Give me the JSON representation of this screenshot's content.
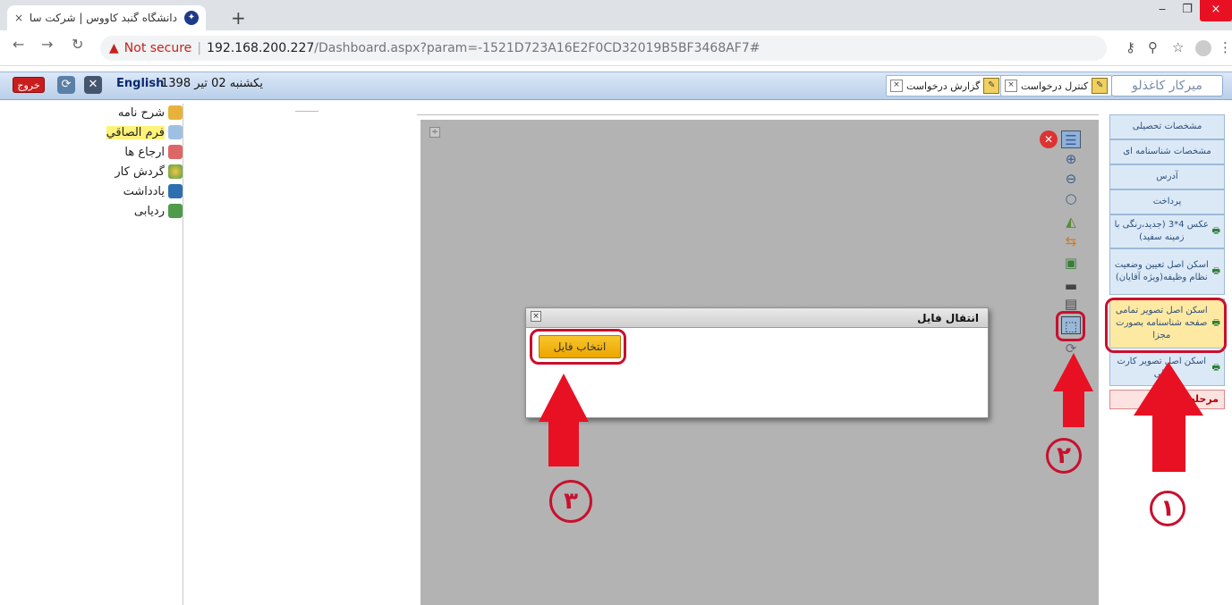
{
  "browser": {
    "tab_title": "دانشگاه گنبد کاووس | شرکت سامان",
    "tab_close": "×",
    "new_tab": "+",
    "security_label": "Not secure",
    "url_host": "192.168.200.227",
    "url_path": "/Dashboard.aspx?param=-1521D723A16E2F0CD32019B5BF3468AF7#",
    "window_controls": [
      "‒",
      "❐",
      "×"
    ]
  },
  "toolbar": {
    "exit_label": "خروج",
    "language": "English",
    "date": "یکشنبه 02 تیر 1398",
    "username": "میرکار کاغذلو",
    "doc_tabs": [
      "کنترل درخواست",
      "گزارش درخواست"
    ]
  },
  "left_panel": {
    "items": [
      {
        "label": "شرح نامه",
        "icon": "envelope-icon",
        "selected": false
      },
      {
        "label": "فرم الصاقي",
        "icon": "document-icon",
        "selected": true
      },
      {
        "label": "ارجاع ها",
        "icon": "forward-icon",
        "selected": false
      },
      {
        "label": "گردش کار",
        "icon": "workflow-icon",
        "selected": false
      },
      {
        "label": "یادداشت",
        "icon": "note-icon",
        "selected": false
      },
      {
        "label": "ردیابی",
        "icon": "tracking-icon",
        "selected": false
      }
    ]
  },
  "viewer": {
    "toggle": "÷",
    "tools": [
      "list-icon",
      "zoom-in-icon",
      "zoom-out-icon",
      "zoom-fit-icon",
      "rotate-icon",
      "swap-icon",
      "save-icon",
      "print-icon",
      "scanner-icon",
      "upload-icon",
      "refresh-icon"
    ]
  },
  "dialog": {
    "title": "انتقال فایل",
    "close": "×",
    "select_file_label": "انتخاب فایل"
  },
  "right_panel": {
    "items": [
      {
        "label": "مشخصات تحصیلی",
        "printer": false,
        "highlight": false
      },
      {
        "label": "مشخصات شناسنامه ای",
        "printer": false,
        "highlight": false
      },
      {
        "label": "آدرس",
        "printer": false,
        "highlight": false
      },
      {
        "label": "پرداخت",
        "printer": false,
        "highlight": false
      },
      {
        "label": "عکس 4*3 (جدید،رنگی با زمینه سفید)",
        "printer": true,
        "highlight": false
      },
      {
        "label": "اسکن اصل تعیین وضعیت نظام وظیفه(ویژه آقایان)",
        "printer": true,
        "highlight": false
      },
      {
        "label": "اسکن اصل تصویر تمامی صفحه شناسنامه بصورت مجزا",
        "printer": true,
        "highlight": true
      },
      {
        "label": "اسکن اصل تصویر کارت ملی",
        "printer": true,
        "highlight": false
      }
    ],
    "stage_label": "مرحله"
  },
  "annotations": {
    "step1": "۱",
    "step2": "۲",
    "step3": "۳",
    "color": "#c8102e"
  }
}
